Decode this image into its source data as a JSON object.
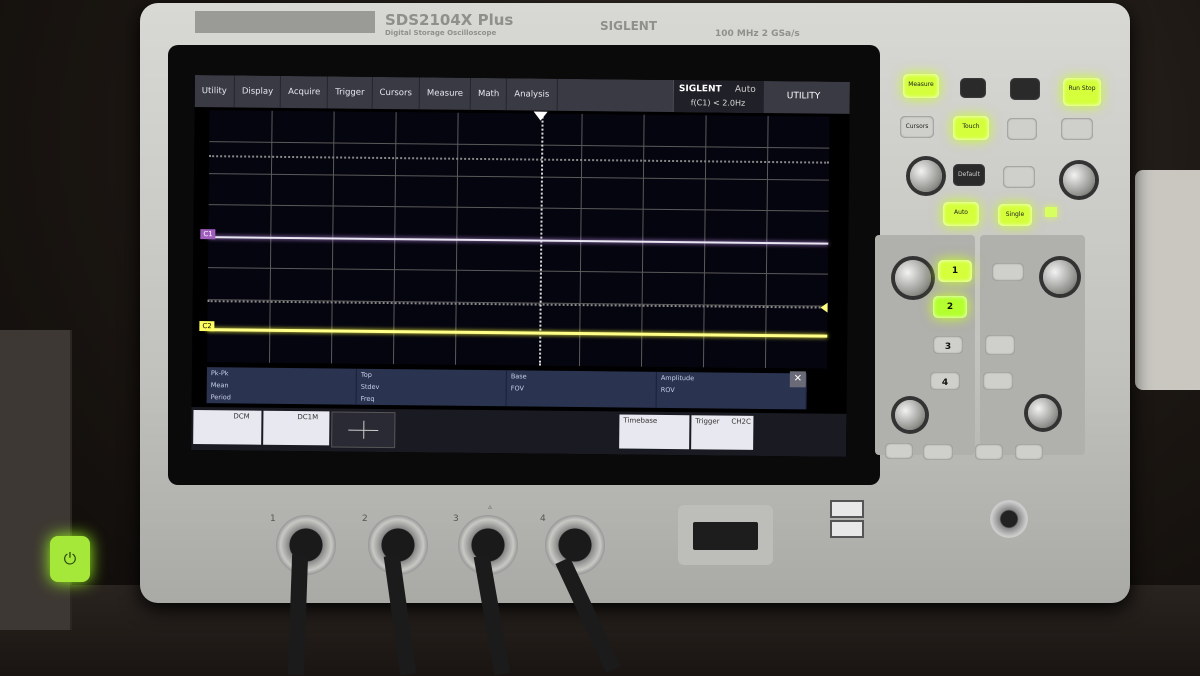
{
  "device": {
    "model": "SDS2104X Plus",
    "model_sub": "Digital Storage Oscilloscope",
    "brand": "SIGLENT",
    "spec": "100 MHz\n2 GSa/s"
  },
  "menu": [
    {
      "label": "Utility",
      "icon": "gear-icon"
    },
    {
      "label": "Display",
      "icon": "display-icon"
    },
    {
      "label": "Acquire",
      "icon": "acquire-icon"
    },
    {
      "label": "Trigger",
      "icon": "trigger-icon"
    },
    {
      "label": "Cursors",
      "icon": "cursor-icon"
    },
    {
      "label": "Measure",
      "icon": "measure-icon"
    },
    {
      "label": "Math",
      "icon": "math-icon"
    },
    {
      "label": "Analysis",
      "icon": "analysis-icon"
    }
  ],
  "trigger_status": {
    "mode": "SIGLENT",
    "auto": "Auto",
    "info": "f(C1) < 2.0Hz"
  },
  "utility_label": "UTILITY",
  "channels": {
    "ch1_marker": "C1",
    "ch2_marker": "C2"
  },
  "measurements": [
    [
      "Pk-Pk",
      "Top",
      "Base",
      "Amplitude"
    ],
    [
      "Mean",
      "Stdev",
      "FOV",
      "ROV"
    ],
    [
      "Period",
      "Freq",
      "",
      ""
    ]
  ],
  "bottom_bar": {
    "ch1": "DCM",
    "ch2": "DC1M",
    "timebase": "Timebase",
    "trigger": "Trigger",
    "trigger_coupling": "CH2C"
  },
  "panel_buttons": {
    "measure": "Measure",
    "run_stop": "Run Stop",
    "cursors": "Cursors",
    "touch": "Touch",
    "default": "Default",
    "auto": "Auto",
    "single": "Single",
    "ch1": "1",
    "ch2": "2",
    "ch3": "3",
    "ch4": "4"
  }
}
